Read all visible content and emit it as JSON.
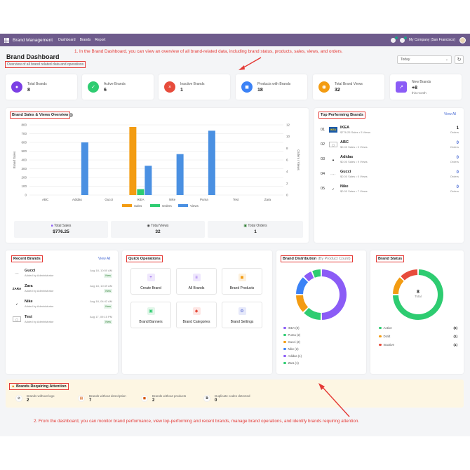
{
  "topbar": {
    "app_title": "Brand Management",
    "nav": [
      "Dashboard",
      "Brands",
      "Report"
    ],
    "company": "My Company (San Francisco)"
  },
  "page": {
    "title": "Brand Dashboard",
    "subtitle": "Overview of all brand related data and operations",
    "period": "Today"
  },
  "annotations": {
    "top": "1. In the Brand Dashboard, you can view an overview of all brand-related data, including brand status, products, sales, views, and orders.",
    "bottom": "2. From the dashboard, you can monitor brand performance, view top-performing and recent brands, manage brand operations, and identify brands requiring attention."
  },
  "stats": [
    {
      "label": "Total Brands",
      "value": "8",
      "color": "#7b3fe4",
      "icon": "tag-icon"
    },
    {
      "label": "Active Brands",
      "value": "6",
      "color": "#2ecc71",
      "icon": "check-icon"
    },
    {
      "label": "Inactive Brands",
      "value": "1",
      "color": "#e74c3c",
      "icon": "close-icon"
    },
    {
      "label": "Products with Brands",
      "value": "18",
      "color": "#3b82f6",
      "icon": "box-icon"
    },
    {
      "label": "Total Brand Views",
      "value": "32",
      "color": "#f39c12",
      "icon": "eye-icon"
    },
    {
      "label": "New Brands",
      "value": "+8",
      "sub": "this month",
      "color": "#8b5cf6",
      "icon": "trend-icon"
    }
  ],
  "sales_chart": {
    "title": "Brand Sales & Views Overview",
    "legend": [
      "Sales",
      "Orders",
      "Views"
    ],
    "totals": {
      "sales_label": "Total Sales",
      "sales_value": "$776.25",
      "views_label": "Total Views",
      "views_value": "32",
      "orders_label": "Total Orders",
      "orders_value": "1"
    }
  },
  "chart_data": {
    "type": "bar",
    "title": "Brand Sales & Views Overview",
    "categories": [
      "ABC",
      "Adidas",
      "Gucci",
      "IKEA",
      "Nike",
      "Puma",
      "Test",
      "Zara"
    ],
    "ylabel": "Brand Sales",
    "y2label": "Orders / Views",
    "ylim": [
      0,
      800
    ],
    "y2lim": [
      0,
      12
    ],
    "yticks": [
      0,
      100,
      200,
      300,
      400,
      500,
      600,
      700,
      800
    ],
    "y2ticks": [
      0,
      2,
      4,
      6,
      8,
      10,
      12
    ],
    "grid": true,
    "legend": "bottom",
    "series": [
      {
        "name": "Sales",
        "axis": "left",
        "color": "#f39c12",
        "values": [
          0,
          0,
          0,
          776.25,
          0,
          0,
          0,
          0
        ]
      },
      {
        "name": "Orders",
        "axis": "right",
        "color": "#2ecc71",
        "values": [
          0,
          0,
          0,
          1,
          0,
          0,
          0,
          0
        ]
      },
      {
        "name": "Views",
        "axis": "right",
        "color": "#4a90e2",
        "values": [
          0,
          9,
          0,
          5,
          7,
          11,
          0,
          0
        ]
      }
    ]
  },
  "top_brands": {
    "title": "Top Performing Brands",
    "view_all": "View All",
    "items": [
      {
        "rank": "01",
        "name": "IKEA",
        "meta": "$776.25 Sales  •  5 Views",
        "orders": "1",
        "orders_label": "Orders"
      },
      {
        "rank": "02",
        "name": "ABC",
        "meta": "$0.00 Sales  •  0 Views",
        "orders": "0",
        "orders_label": "Orders"
      },
      {
        "rank": "03",
        "name": "Adidas",
        "meta": "$0.00 Sales  •  9 Views",
        "orders": "0",
        "orders_label": "Orders"
      },
      {
        "rank": "04",
        "name": "Gucci",
        "meta": "$0.00 Sales  •  0 Views",
        "orders": "0",
        "orders_label": "Orders"
      },
      {
        "rank": "05",
        "name": "Nike",
        "meta": "$0.00 Sales  •  7 Views",
        "orders": "0",
        "orders_label": "Orders"
      }
    ]
  },
  "recent_brands": {
    "title": "Recent Brands",
    "view_all": "View All",
    "items": [
      {
        "name": "Gucci",
        "by": "Added by Administrator",
        "date": "Aug 18, 10:50 AM",
        "badge": "New"
      },
      {
        "name": "Zara",
        "by": "Added by Administrator",
        "date": "Aug 18, 10:49 AM",
        "badge": "New"
      },
      {
        "name": "Nike",
        "by": "Added by Administrator",
        "date": "Aug 18, 04:42 AM",
        "badge": "New"
      },
      {
        "name": "Test",
        "by": "Added by Administrator",
        "date": "Aug 17, 09:15 PM",
        "badge": "New"
      }
    ]
  },
  "quick_ops": {
    "title": "Quick Operations",
    "items": [
      {
        "label": "Create Brand",
        "icon": "plus-icon",
        "color": "#7b3fe4",
        "bg": "#efe7fd"
      },
      {
        "label": "All Brands",
        "icon": "list-icon",
        "color": "#7b3fe4",
        "bg": "#efe7fd"
      },
      {
        "label": "Brand Products",
        "icon": "box-icon",
        "color": "#f39c12",
        "bg": "#fdf0dc"
      },
      {
        "label": "Brand Banners",
        "icon": "image-icon",
        "color": "#2ecc71",
        "bg": "#e3f6ea"
      },
      {
        "label": "Brand Categories",
        "icon": "tag-icon",
        "color": "#e74c3c",
        "bg": "#fde6e4"
      },
      {
        "label": "Brand Settings",
        "icon": "gear-icon",
        "color": "#5b6bd6",
        "bg": "#e6e9fa"
      }
    ]
  },
  "distribution": {
    "title": "Brand Distribution",
    "title_muted": "(By Product Count)",
    "items": [
      {
        "label": "IKEA (8)",
        "value": 8,
        "color": "#8b5cf6"
      },
      {
        "label": "Puma (2)",
        "value": 2,
        "color": "#2ecc71"
      },
      {
        "label": "Gucci (2)",
        "value": 2,
        "color": "#f39c12"
      },
      {
        "label": "Nike (2)",
        "value": 2,
        "color": "#3b82f6"
      },
      {
        "label": "Adidas (1)",
        "value": 1,
        "color": "#8b5cf6"
      },
      {
        "label": "Zara (1)",
        "value": 1,
        "color": "#2ecc71"
      }
    ]
  },
  "status": {
    "title": "Brand Status",
    "center_value": "8",
    "center_label": "Total",
    "items": [
      {
        "label": "Active",
        "count": "(6)",
        "value": 6,
        "color": "#2ecc71"
      },
      {
        "label": "Draft",
        "count": "(1)",
        "value": 1,
        "color": "#f39c12"
      },
      {
        "label": "Inactive",
        "count": "(1)",
        "value": 1,
        "color": "#e74c3c"
      }
    ]
  },
  "attention": {
    "title": "Brands Requiring Attention",
    "items": [
      {
        "label": "Brands without logo",
        "value": "2",
        "icon": "no-logo-icon"
      },
      {
        "label": "Brands without description",
        "value": "7",
        "icon": "document-icon"
      },
      {
        "label": "Brands without products",
        "value": "2",
        "icon": "box-icon"
      },
      {
        "label": "Duplicate codes detected",
        "value": "0",
        "icon": "duplicate-icon"
      }
    ]
  }
}
